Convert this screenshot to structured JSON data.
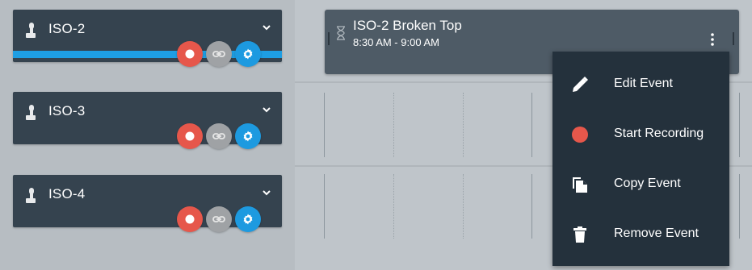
{
  "sources": [
    {
      "name": "ISO-2"
    },
    {
      "name": "ISO-3"
    },
    {
      "name": "ISO-4"
    }
  ],
  "event": {
    "title": "ISO-2 Broken Top",
    "time": "8:30 AM - 9:00 AM"
  },
  "menu": {
    "items": [
      {
        "label": "Edit Event"
      },
      {
        "label": "Start Recording"
      },
      {
        "label": "Copy Event"
      },
      {
        "label": "Remove Event"
      }
    ]
  },
  "colors": {
    "record": "#e6574b",
    "link": "#9fa2a5",
    "settings": "#1d9ae0",
    "active_bar": "#1e9ee3",
    "card": "#35434f",
    "menu": "#24313c"
  }
}
